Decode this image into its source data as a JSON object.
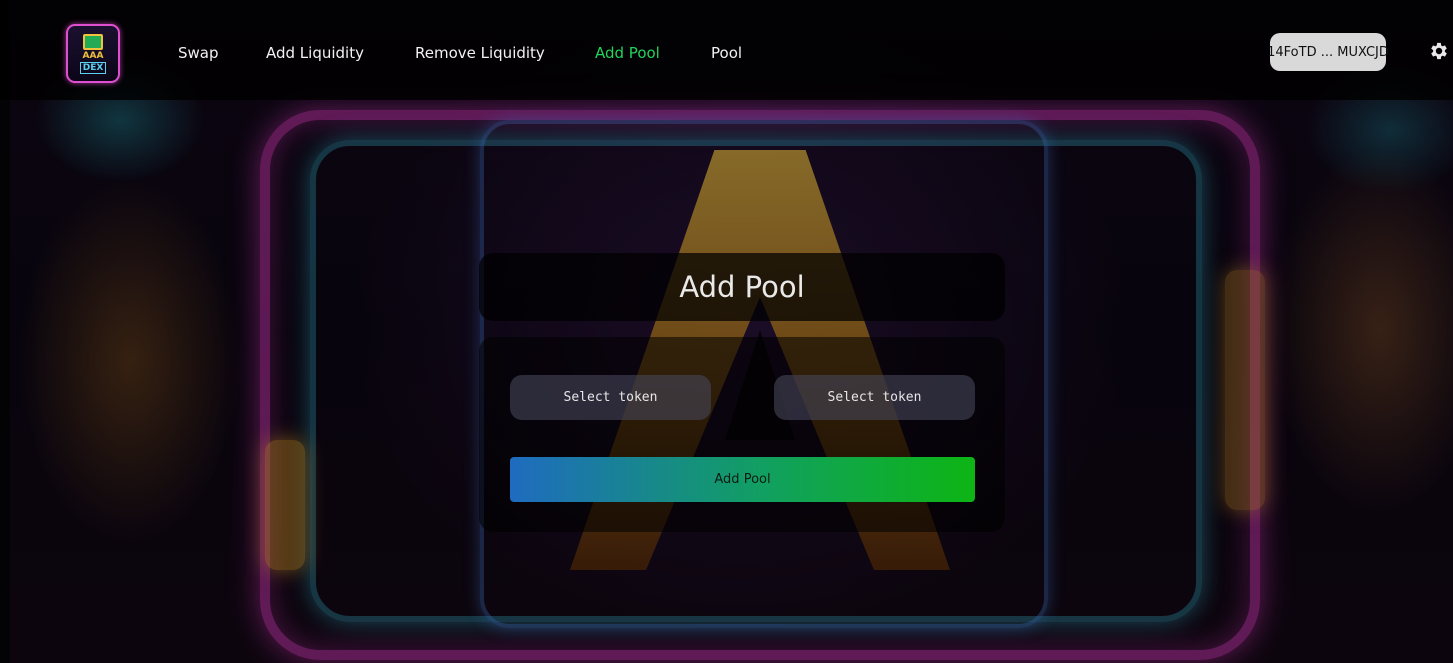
{
  "logo": {
    "line1": "AAA",
    "line2": "DEX"
  },
  "nav": {
    "items": [
      {
        "label": "Swap"
      },
      {
        "label": "Add Liquidity"
      },
      {
        "label": "Remove Liquidity"
      },
      {
        "label": "Add Pool"
      },
      {
        "label": "Pool"
      }
    ],
    "active": "Add Pool",
    "active_color": "#22d45a"
  },
  "wallet": {
    "address": "14FoTD ... MUXCJD"
  },
  "settings": {
    "icon": "gear-icon"
  },
  "main": {
    "title": "Add Pool",
    "token_a_label": "Select token",
    "token_b_label": "Select token",
    "submit_label": "Add Pool"
  }
}
